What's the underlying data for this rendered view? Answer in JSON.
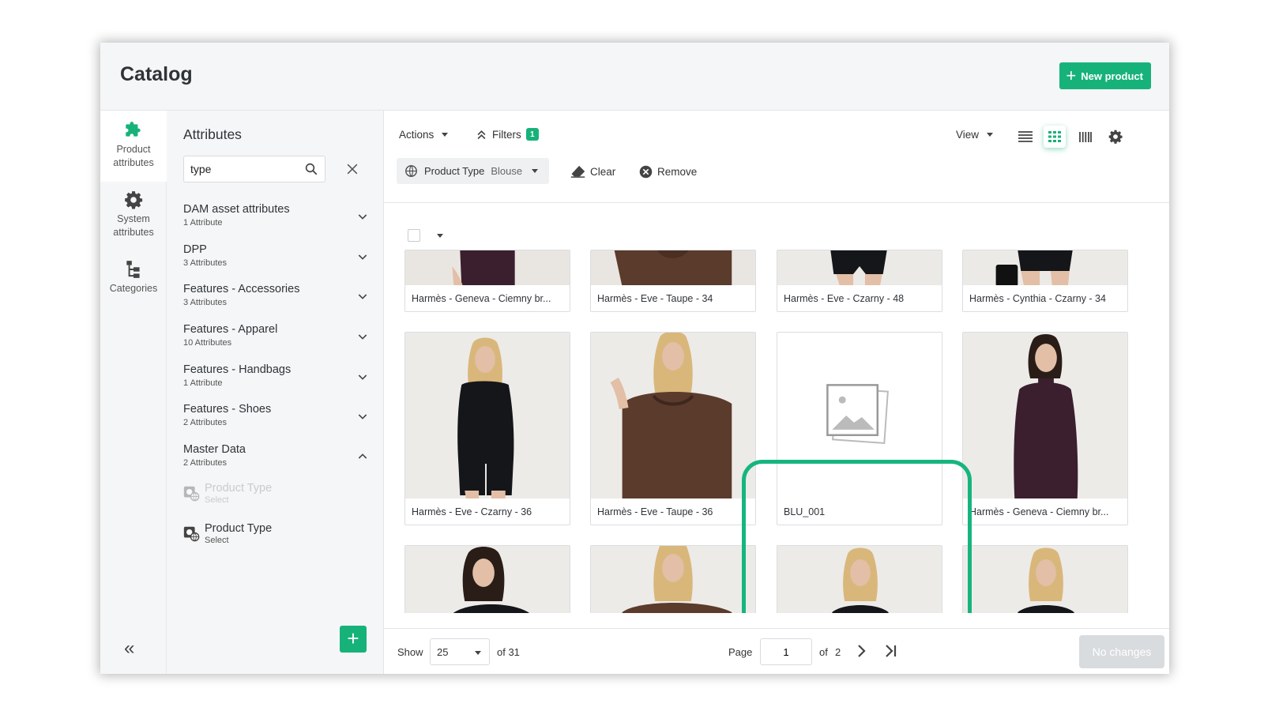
{
  "header": {
    "title": "Catalog",
    "new_product_label": "New product"
  },
  "rail": {
    "items": [
      {
        "label_line1": "Product",
        "label_line2": "attributes"
      },
      {
        "label_line1": "System",
        "label_line2": "attributes"
      },
      {
        "label_line1": "Categories",
        "label_line2": ""
      }
    ]
  },
  "attributes": {
    "title": "Attributes",
    "search_value": "type",
    "groups": [
      {
        "name": "DAM asset attributes",
        "count": "1 Attribute"
      },
      {
        "name": "DPP",
        "count": "3 Attributes"
      },
      {
        "name": "Features - Accessories",
        "count": "3 Attributes"
      },
      {
        "name": "Features - Apparel",
        "count": "10 Attributes"
      },
      {
        "name": "Features - Handbags",
        "count": "1 Attribute"
      },
      {
        "name": "Features - Shoes",
        "count": "2 Attributes"
      },
      {
        "name": "Master Data",
        "count": "2 Attributes"
      }
    ],
    "items": [
      {
        "name": "Product Type",
        "type": "Select"
      },
      {
        "name": "Product Type",
        "type": "Select"
      }
    ]
  },
  "toolbar": {
    "actions_label": "Actions",
    "filters_label": "Filters",
    "filters_count": "1",
    "view_label": "View",
    "chip_name": "Product Type",
    "chip_value": "Blouse",
    "clear_label": "Clear",
    "remove_label": "Remove"
  },
  "products": {
    "row1": [
      "Harmès - Geneva - Ciemny br...",
      "Harmès - Eve - Taupe - 34",
      "Harmès - Eve - Czarny - 48",
      "Harmès - Cynthia - Czarny - 34"
    ],
    "row2": [
      "Harmès - Eve - Czarny - 36",
      "Harmès - Eve - Taupe - 36",
      "BLU_001",
      "Harmès - Geneva - Ciemny br..."
    ]
  },
  "footer": {
    "show_label": "Show",
    "per_page": "25",
    "total": "of 31",
    "page_label": "Page",
    "page_value": "1",
    "of_pages": "of",
    "pages_total": "2",
    "no_changes_label": "No changes"
  },
  "colors": {
    "accent": "#17b27a",
    "highlight": "#16b57f",
    "skin": "#e2bfa6",
    "brown": "#5b3b2c",
    "black": "#15161a",
    "plum": "#3b1f2e"
  }
}
